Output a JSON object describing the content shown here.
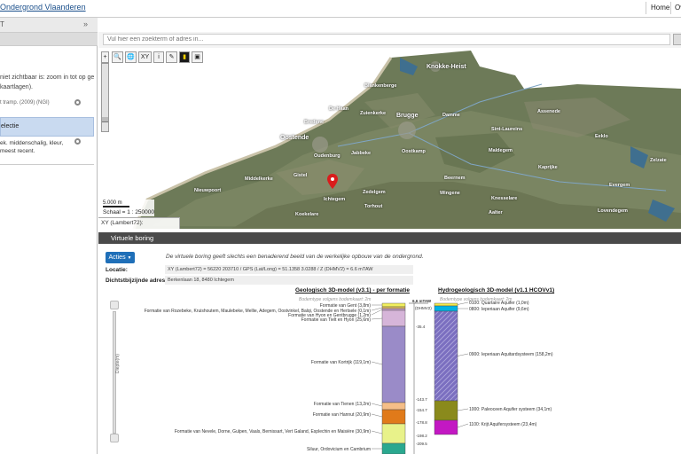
{
  "header": {
    "site_title": "Ondergrond Vlaanderen",
    "home_link": "Home",
    "overview_link": "Ov"
  },
  "sidebar": {
    "head_label": "T",
    "collapse_icon": "double-chevron-right-icon",
    "warning_text": "niet zichtbaar is: zoom in tot op ge kaartlagen).",
    "item1_label": "t tramp. (2009) (NGI)",
    "selected_label": "electie",
    "item2_label": "ek. middenschalig, kleur, meest recent."
  },
  "search": {
    "placeholder": "Vul hier een zoekterm of adres in..."
  },
  "map": {
    "tools": [
      "+",
      "🔍",
      "🌐",
      "XY",
      "i",
      "✎",
      "▮",
      "▣"
    ],
    "scale_bar_label": "5.000 m",
    "scale_text": "Schaal = 1 : 250000",
    "coord_text": "XY (Lambert72):",
    "towns": [
      "Knokke-Heist",
      "Brugge",
      "Oostende"
    ],
    "places": [
      "Blankenberge",
      "De Haan",
      "Zuienkerke",
      "Damme",
      "Bredene",
      "Jabbeke",
      "Oostkamp",
      "Gistel",
      "Oudenburg",
      "Ichtegem",
      "Zedelgem",
      "Beernem",
      "Torhout",
      "Koekelare",
      "Maldegem",
      "Eeklo",
      "Kaprijke",
      "Aalter",
      "Nieuwpoort",
      "Middelkerke",
      "Zelzate",
      "Evergem",
      "Assenede",
      "Sint-Laureins",
      "Knesselare",
      "Wingene",
      "Lovendegem"
    ]
  },
  "panel": {
    "title": "Virtuele boring"
  },
  "boring": {
    "acties_label": "Acties",
    "disclaimer": "De virtuele boring geeft slechts een benaderend beeld van de werkelijke opbouw van de ondergrond.",
    "location_label": "Locatie:",
    "location_value": "XY (Lambert72) = 56220 203710 / GPS (Lat/Long) = 51.1358 3.0288 / Z (DHMV2) = 6.6 mTAW",
    "address_label": "Dichtstbijzijnde adres:",
    "address_value": "Berkenlaan 18, 8480 Ichtegem",
    "depth_label": "Diepte(m)",
    "geo_title": "Geologisch 3D-model (v3.1) - per formatie",
    "geo_subtitle": "Bodemtype volgens bodemkaart: 2m",
    "hydro_title": "Hydrogeologisch 3D-model (v1.1 HCOVv1)",
    "hydro_subtitle": "Bodemtype volgens bodemkaart: 2m",
    "surface_label": "6,6 mTAW",
    "dhmv_label": "(DHMV2)"
  },
  "chart_data": {
    "type": "table",
    "geo_formations": [
      {
        "name": "Formatie van Gent (3,8m)",
        "color": "#f1ef5e"
      },
      {
        "name": "Formatie van Rozebeke, Kruishoutem, Maulebeke, Mellie, Adegem, Oostvinkel, Balqi, Oostende en Hertsele (0,1m)",
        "color": "#e9c35e"
      },
      {
        "name": "Formatie van Hyon en Gentbrugge (1,2m)",
        "color": "#cda3d1"
      },
      {
        "name": "Formatie van Tielt en Hyon (25,6m)",
        "color": "#d6b5d9"
      },
      {
        "name": "Formatie van Kortrijk (119,1m)",
        "color": "#9a8bc8"
      },
      {
        "name": "Formatie van Tienen (13,2m)",
        "color": "#f5be88"
      },
      {
        "name": "Formatie van Hannut (20,9m)",
        "color": "#e07a1a"
      },
      {
        "name": "Formatie van Nevele, Dorne, Gulpen, Vaals, Bernissart, Vert Galand, Esplechin en Maisière (30,9m)",
        "color": "#e8f28a"
      },
      {
        "name": "Siluur, Ordovicium en Cambrium",
        "color": "#2aa88f"
      }
    ],
    "depths": [
      "-35.4",
      "-143.7",
      "-154.7",
      "-178.8",
      "-198.2",
      "-209.5"
    ],
    "hydro_units": [
      {
        "name": "0100: Quartaire Aquifer (1,0m)",
        "color": "#f2e94e"
      },
      {
        "name": "0800: Ieperiaan Aquifer (9,6m)",
        "color": "#00b3e3"
      },
      {
        "name": "0900: Ieperiaan Aquitardsysteem (158,2m)",
        "color": "#7b6fc0"
      },
      {
        "name": "1000: Paleoceen Aquifer systeem (34,1m)",
        "color": "#8a8a1c"
      },
      {
        "name": "1100: Krijt Aquifersysteem (23,4m)",
        "color": "#c318c3"
      }
    ]
  }
}
